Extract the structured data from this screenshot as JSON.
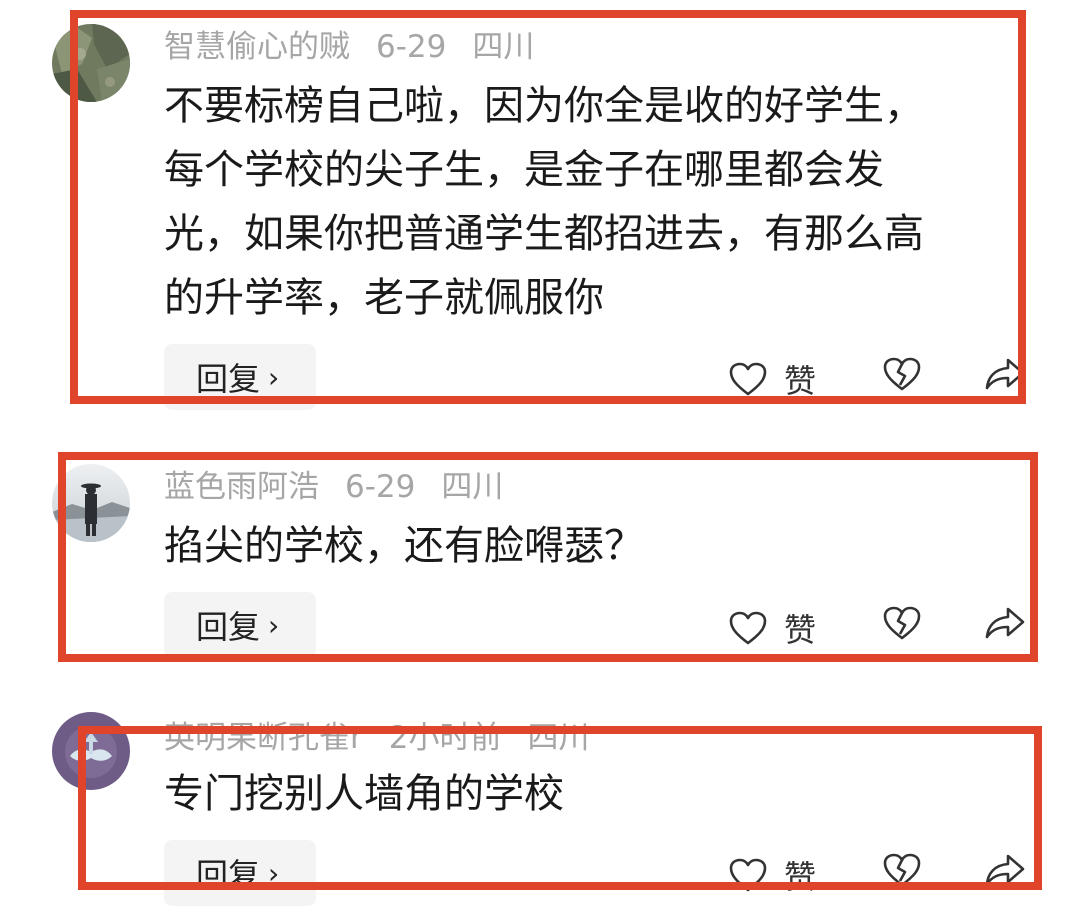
{
  "comments": [
    {
      "username": "智慧偷心的贼",
      "date": "6-29",
      "location": "四川",
      "text_lines": [
        "不要标榜自己啦，因为你全是收的好学生，",
        "每个学校的尖子生，是金子在哪里都会发",
        "光，如果你把普通学生都招进去，有那么高",
        "的升学率，老子就佩服你"
      ],
      "reply_label": "回复",
      "like_label": "赞"
    },
    {
      "username": "蓝色雨阿浩",
      "date": "6-29",
      "location": "四川",
      "text_lines": [
        "掐尖的学校，还有脸嘚瑟？"
      ],
      "reply_label": "回复",
      "like_label": "赞"
    },
    {
      "username": "英明果断孔雀r",
      "date": "2小时前",
      "location": "四川",
      "text_lines": [
        "专门挖别人墙角的学校"
      ],
      "reply_label": "回复",
      "like_label": "赞"
    }
  ],
  "icons": {
    "like": "heart-outline-icon",
    "dislike": "broken-heart-icon",
    "share": "share-arrow-icon",
    "reply_chevron": "chevron-right-icon"
  },
  "colors": {
    "highlight_border": "#e0452c",
    "meta_text": "#a6a6a6",
    "reply_bg": "#f4f4f4"
  }
}
